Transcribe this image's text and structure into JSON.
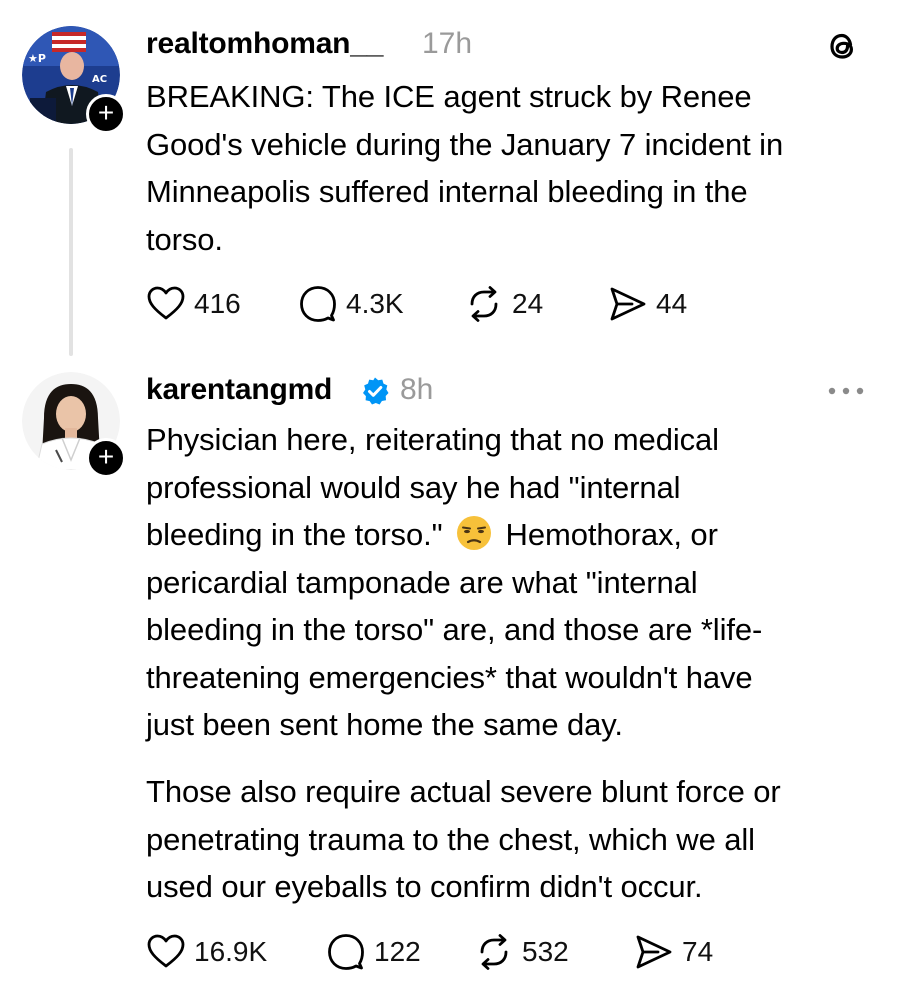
{
  "app": {
    "logo_icon": "threads-logo-icon"
  },
  "posts": [
    {
      "username": "realtomhoman__",
      "time": "17h",
      "verified": false,
      "avatar_badge": "+",
      "lines": [
        "BREAKING: The ICE agent struck by Renee",
        "Good's vehicle during the January 7 incident in",
        "Minneapolis suffered internal bleeding in the",
        "torso."
      ],
      "likes": "416",
      "replies": "4.3K",
      "reposts": "24",
      "shares": "44"
    },
    {
      "username": "karentangmd",
      "time": "8h",
      "verified": true,
      "avatar_badge": "+",
      "more_icon": "more-dots-icon",
      "paragraph1": {
        "line1": "Physician here, reiterating that no medical",
        "line2": "professional would say he had \"internal",
        "line3_before_emoji": "bleeding in the torso.\"",
        "emoji": "unamused-face-emoji",
        "line3_after_emoji": "Hemothorax, or",
        "line4": "pericardial tamponade are what \"internal",
        "line5": "bleeding in the torso\" are, and those are *life-",
        "line6": "threatening emergencies* that wouldn't have",
        "line7": "just been sent home the same day."
      },
      "paragraph2": [
        "Those also require actual severe blunt force or",
        "penetrating trauma to the chest, which we all",
        "used our eyeballs to confirm didn't occur."
      ],
      "likes": "16.9K",
      "replies": "122",
      "reposts": "532",
      "shares": "74"
    }
  ],
  "colors": {
    "time_gray": "#9a9a9a",
    "verified_blue": "#0095f6",
    "thread_line": "#e2e2e2"
  }
}
